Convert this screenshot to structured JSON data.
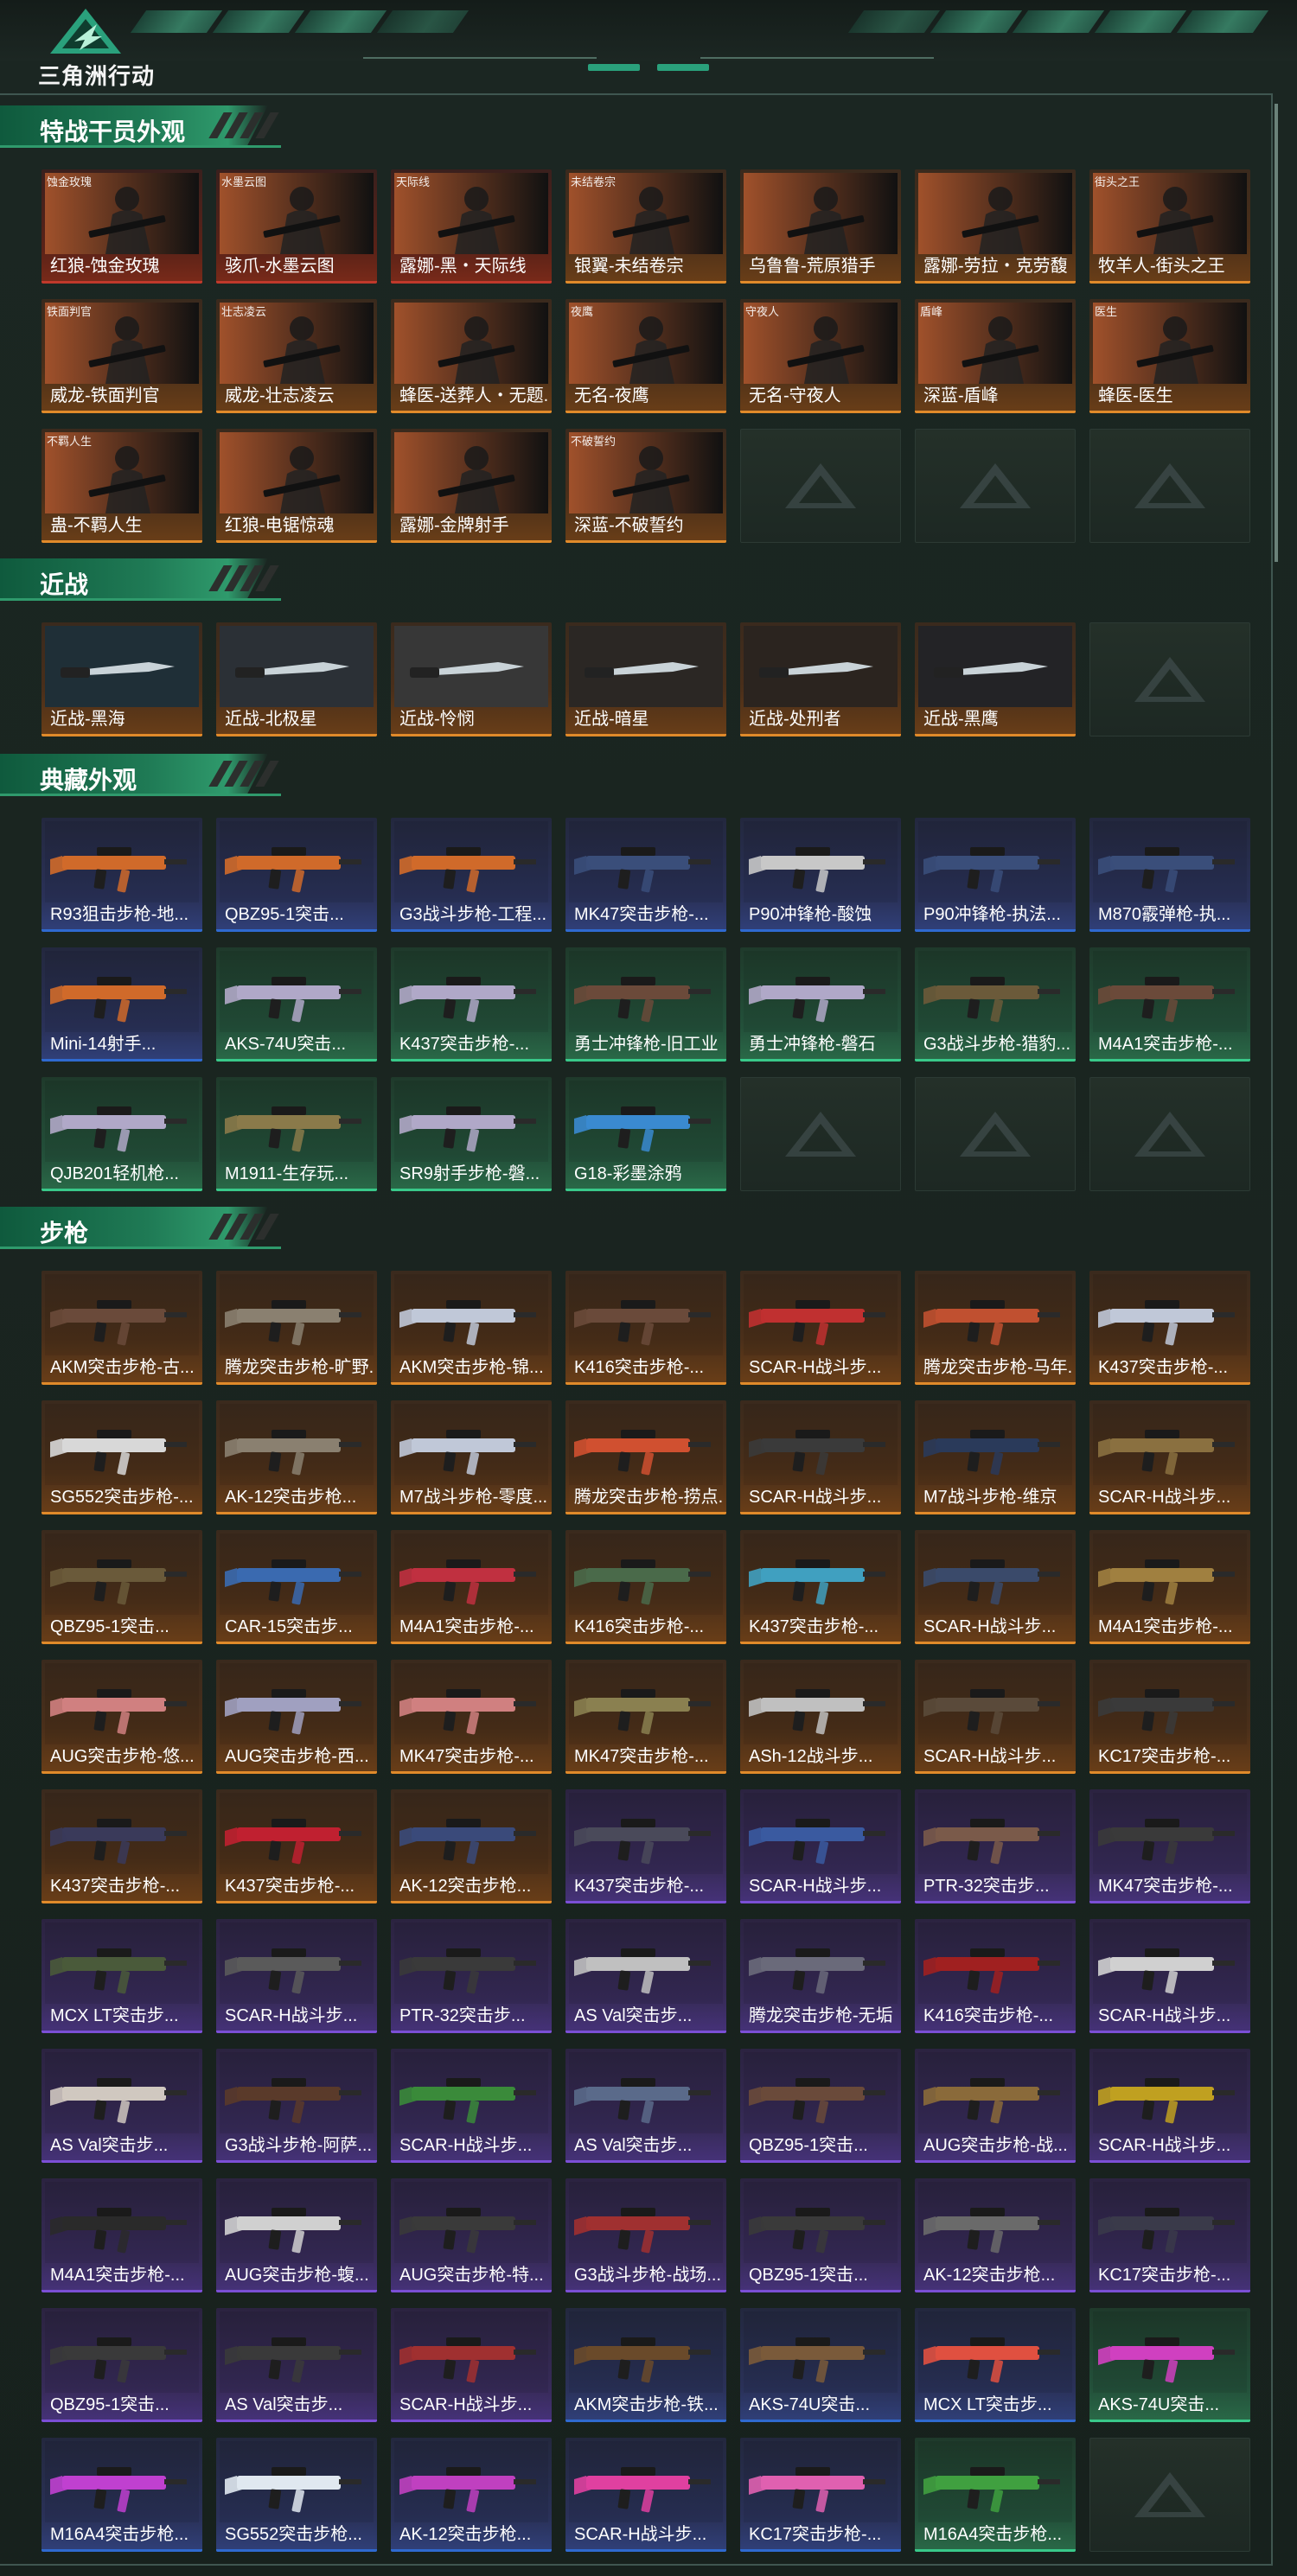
{
  "app": {
    "logo_text": "三角洲行动"
  },
  "colors": {
    "gold": "#e08a2a",
    "red": "#c0392b",
    "blue": "#2f6ad0",
    "purple": "#7b4fd6",
    "green": "#39c98a"
  },
  "sections": {
    "operators": {
      "title": "特战干员外观",
      "items": [
        {
          "label": "红狼-蚀金玫瑰",
          "tag": "蚀金玫瑰",
          "quality": "red",
          "theme": "#a0512b"
        },
        {
          "label": "骇爪-水墨云图",
          "tag": "水墨云图",
          "quality": "red",
          "theme": "#6c7680"
        },
        {
          "label": "露娜-黑・天际线",
          "tag": "天际线",
          "quality": "red",
          "theme": "#3a4a70"
        },
        {
          "label": "银翼-未结卷宗",
          "tag": "未结卷宗",
          "quality": "gold",
          "theme": "#2c4a5a"
        },
        {
          "label": "乌鲁鲁-荒原猎手",
          "tag": "",
          "quality": "gold",
          "theme": "#3d6b86"
        },
        {
          "label": "露娜-劳拉・克劳馥",
          "tag": "",
          "quality": "gold",
          "theme": "#2f5660"
        },
        {
          "label": "牧羊人-街头之王",
          "tag": "街头之王",
          "quality": "gold",
          "theme": "#47616a"
        },
        {
          "label": "威龙-铁面判官",
          "tag": "铁面判官",
          "quality": "gold",
          "theme": "#2c5660"
        },
        {
          "label": "威龙-壮志凌云",
          "tag": "壮志凌云",
          "quality": "gold",
          "theme": "#3c4c52"
        },
        {
          "label": "蜂医-送葬人・无题...",
          "tag": "",
          "quality": "gold",
          "theme": "#2a6670"
        },
        {
          "label": "无名-夜鹰",
          "tag": "夜鹰",
          "quality": "gold",
          "theme": "#2d4050"
        },
        {
          "label": "无名-守夜人",
          "tag": "守夜人",
          "quality": "gold",
          "theme": "#2b2f33"
        },
        {
          "label": "深蓝-盾峰",
          "tag": "盾峰",
          "quality": "gold",
          "theme": "#3a6170"
        },
        {
          "label": "蜂医-医生",
          "tag": "医生",
          "quality": "gold",
          "theme": "#3b6070"
        },
        {
          "label": "蛊-不羁人生",
          "tag": "不羁人生",
          "quality": "gold",
          "theme": "#4a3350"
        },
        {
          "label": "红狼-电锯惊魂",
          "tag": "",
          "quality": "gold",
          "theme": "#4c2a26"
        },
        {
          "label": "露娜-金牌射手",
          "tag": "",
          "quality": "gold",
          "theme": "#6a5a4a"
        },
        {
          "label": "深蓝-不破誓约",
          "tag": "不破誓约",
          "quality": "gold",
          "theme": "#2c5a5e"
        },
        {
          "empty": true
        },
        {
          "empty": true
        },
        {
          "empty": true
        }
      ]
    },
    "melee": {
      "title": "近战",
      "items": [
        {
          "label": "近战-黑海",
          "quality": "gold",
          "theme": "#2a3f4a"
        },
        {
          "label": "近战-北极星",
          "quality": "gold",
          "theme": "#3a4048"
        },
        {
          "label": "近战-怜悯",
          "quality": "gold",
          "theme": "#4a4a4a"
        },
        {
          "label": "近战-暗星",
          "quality": "gold",
          "theme": "#3a3430"
        },
        {
          "label": "近战-处刑者",
          "quality": "gold",
          "theme": "#3a302a"
        },
        {
          "label": "近战-黑鹰",
          "quality": "gold",
          "theme": "#2f2f33"
        },
        {
          "empty": true
        }
      ]
    },
    "collection": {
      "title": "典藏外观",
      "items": [
        {
          "label": "R93狙击步枪-地...",
          "quality": "blue",
          "theme": "#d06a2a"
        },
        {
          "label": "QBZ95-1突击...",
          "quality": "blue",
          "theme": "#d06a2a"
        },
        {
          "label": "G3战斗步枪-工程...",
          "quality": "blue",
          "theme": "#d06a2a"
        },
        {
          "label": "MK47突击步枪-...",
          "quality": "blue",
          "theme": "#3a4e7a"
        },
        {
          "label": "P90冲锋枪-酸蚀",
          "quality": "blue",
          "theme": "#c8c8c8"
        },
        {
          "label": "P90冲锋枪-执法...",
          "quality": "blue",
          "theme": "#3a4e7a"
        },
        {
          "label": "M870霰弹枪-执...",
          "quality": "blue",
          "theme": "#3a4e7a"
        },
        {
          "label": "Mini-14射手...",
          "quality": "blue",
          "theme": "#d06a2a"
        },
        {
          "label": "AKS-74U突击...",
          "quality": "green",
          "theme": "#b0a8c8"
        },
        {
          "label": "K437突击步枪-...",
          "quality": "green",
          "theme": "#b0a8c8"
        },
        {
          "label": "勇士冲锋枪-旧工业",
          "quality": "green",
          "theme": "#6b4a3a"
        },
        {
          "label": "勇士冲锋枪-磐石",
          "quality": "green",
          "theme": "#b0a8c8"
        },
        {
          "label": "G3战斗步枪-猎豹...",
          "quality": "green",
          "theme": "#6b5a3a"
        },
        {
          "label": "M4A1突击步枪-...",
          "quality": "green",
          "theme": "#6b4a3a"
        },
        {
          "label": "QJB201轻机枪...",
          "quality": "green",
          "theme": "#b0a8c8"
        },
        {
          "label": "M1911-生存玩...",
          "quality": "green",
          "theme": "#8a7a4a"
        },
        {
          "label": "SR9射手步枪-磐...",
          "quality": "green",
          "theme": "#b0a8c8"
        },
        {
          "label": "G18-彩墨涂鸦",
          "quality": "green",
          "theme": "#3a8ad0"
        },
        {
          "empty": true
        },
        {
          "empty": true
        },
        {
          "empty": true
        }
      ]
    },
    "rifles": {
      "title": "步枪",
      "items": [
        {
          "label": "AKM突击步枪-古...",
          "quality": "gold",
          "theme": "#6a4a3a"
        },
        {
          "label": "腾龙突击步枪-旷野...",
          "quality": "gold",
          "theme": "#8a8070"
        },
        {
          "label": "AKM突击步枪-锦...",
          "quality": "gold",
          "theme": "#c0c8d8"
        },
        {
          "label": "K416突击步枪-...",
          "quality": "gold",
          "theme": "#6a4a3a"
        },
        {
          "label": "SCAR-H战斗步...",
          "quality": "gold",
          "theme": "#c03030"
        },
        {
          "label": "腾龙突击步枪-马年...",
          "quality": "gold",
          "theme": "#c05030"
        },
        {
          "label": "K437突击步枪-...",
          "quality": "gold",
          "theme": "#c0c8d8"
        },
        {
          "label": "SG552突击步枪-...",
          "quality": "gold",
          "theme": "#d8d8d8"
        },
        {
          "label": "AK-12突击步枪...",
          "quality": "gold",
          "theme": "#8a8070"
        },
        {
          "label": "M7战斗步枪-零度...",
          "quality": "gold",
          "theme": "#c0c8d8"
        },
        {
          "label": "腾龙突击步枪-捞点...",
          "quality": "gold",
          "theme": "#d05030"
        },
        {
          "label": "SCAR-H战斗步...",
          "quality": "gold",
          "theme": "#3a3a3a"
        },
        {
          "label": "M7战斗步枪-维京",
          "quality": "gold",
          "theme": "#2a3a5a"
        },
        {
          "label": "SCAR-H战斗步...",
          "quality": "gold",
          "theme": "#8a7040"
        },
        {
          "label": "QBZ95-1突击...",
          "quality": "gold",
          "theme": "#6a5a3a"
        },
        {
          "label": "CAR-15突击步...",
          "quality": "gold",
          "theme": "#3a6ab0"
        },
        {
          "label": "M4A1突击步枪-...",
          "quality": "gold",
          "theme": "#c03040"
        },
        {
          "label": "K416突击步枪-...",
          "quality": "gold",
          "theme": "#4a6a4a"
        },
        {
          "label": "K437突击步枪-...",
          "quality": "gold",
          "theme": "#40a0c0"
        },
        {
          "label": "SCAR-H战斗步...",
          "quality": "gold",
          "theme": "#3a4a6a"
        },
        {
          "label": "M4A1突击步枪-...",
          "quality": "gold",
          "theme": "#a08040"
        },
        {
          "label": "AUG突击步枪-悠...",
          "quality": "gold",
          "theme": "#d08080"
        },
        {
          "label": "AUG突击步枪-西...",
          "quality": "gold",
          "theme": "#a0a0c0"
        },
        {
          "label": "MK47突击步枪-...",
          "quality": "gold",
          "theme": "#d08080"
        },
        {
          "label": "MK47突击步枪-...",
          "quality": "gold",
          "theme": "#8a8050"
        },
        {
          "label": "ASh-12战斗步...",
          "quality": "gold",
          "theme": "#c0c0c0"
        },
        {
          "label": "SCAR-H战斗步...",
          "quality": "gold",
          "theme": "#5a4a3a"
        },
        {
          "label": "KC17突击步枪-...",
          "quality": "gold",
          "theme": "#3a3a3a"
        },
        {
          "label": "K437突击步枪-...",
          "quality": "gold",
          "theme": "#3a3a5a"
        },
        {
          "label": "K437突击步枪-...",
          "quality": "gold",
          "theme": "#c02030"
        },
        {
          "label": "AK-12突击步枪...",
          "quality": "gold",
          "theme": "#3a4a7a"
        },
        {
          "label": "K437突击步枪-...",
          "quality": "purple",
          "theme": "#4a4a5a"
        },
        {
          "label": "SCAR-H战斗步...",
          "quality": "purple",
          "theme": "#3a5aa0"
        },
        {
          "label": "PTR-32突击步...",
          "quality": "purple",
          "theme": "#7a5a4a"
        },
        {
          "label": "MK47突击步枪-...",
          "quality": "purple",
          "theme": "#3a3a3a"
        },
        {
          "label": "MCX LT突击步...",
          "quality": "purple",
          "theme": "#4a5a3a"
        },
        {
          "label": "SCAR-H战斗步...",
          "quality": "purple",
          "theme": "#5a5a5a"
        },
        {
          "label": "PTR-32突击步...",
          "quality": "purple",
          "theme": "#3a3a3a"
        },
        {
          "label": "AS Val突击步...",
          "quality": "purple",
          "theme": "#c0c0c0"
        },
        {
          "label": "腾龙突击步枪-无垢",
          "quality": "purple",
          "theme": "#6a6a7a"
        },
        {
          "label": "K416突击步枪-...",
          "quality": "purple",
          "theme": "#a02020"
        },
        {
          "label": "SCAR-H战斗步...",
          "quality": "purple",
          "theme": "#d0d0d0"
        },
        {
          "label": "AS Val突击步...",
          "quality": "purple",
          "theme": "#d0c8c0"
        },
        {
          "label": "G3战斗步枪-阿萨...",
          "quality": "purple",
          "theme": "#5a3a2a"
        },
        {
          "label": "SCAR-H战斗步...",
          "quality": "purple",
          "theme": "#3a8a3a"
        },
        {
          "label": "AS Val突击步...",
          "quality": "purple",
          "theme": "#5a6a8a"
        },
        {
          "label": "QBZ95-1突击...",
          "quality": "purple",
          "theme": "#6a4a3a"
        },
        {
          "label": "AUG突击步枪-战...",
          "quality": "purple",
          "theme": "#8a6a3a"
        },
        {
          "label": "SCAR-H战斗步...",
          "quality": "purple",
          "theme": "#c0a020"
        },
        {
          "label": "M4A1突击步枪-...",
          "quality": "purple",
          "theme": "#2a2a2a"
        },
        {
          "label": "AUG突击步枪-蝮...",
          "quality": "purple",
          "theme": "#d0d0d0"
        },
        {
          "label": "AUG突击步枪-特...",
          "quality": "purple",
          "theme": "#3a3a3a"
        },
        {
          "label": "G3战斗步枪-战场...",
          "quality": "purple",
          "theme": "#a03030"
        },
        {
          "label": "QBZ95-1突击...",
          "quality": "purple",
          "theme": "#3a3a3a"
        },
        {
          "label": "AK-12突击步枪...",
          "quality": "purple",
          "theme": "#6a6a6a"
        },
        {
          "label": "KC17突击步枪-...",
          "quality": "purple",
          "theme": "#3a3a4a"
        },
        {
          "label": "QBZ95-1突击...",
          "quality": "purple",
          "theme": "#3a3a3a"
        },
        {
          "label": "AS Val突击步...",
          "quality": "purple",
          "theme": "#3a3a3a"
        },
        {
          "label": "SCAR-H战斗步...",
          "quality": "purple",
          "theme": "#a03030"
        },
        {
          "label": "AKM突击步枪-铁...",
          "quality": "blue",
          "theme": "#6a4a2a"
        },
        {
          "label": "AKS-74U突击...",
          "quality": "blue",
          "theme": "#7a5a3a"
        },
        {
          "label": "MCX LT突击步...",
          "quality": "blue",
          "theme": "#e05040"
        },
        {
          "label": "AKS-74U突击...",
          "quality": "green",
          "theme": "#d040c0"
        },
        {
          "label": "M16A4突击步枪...",
          "quality": "blue",
          "theme": "#c040d0"
        },
        {
          "label": "SG552突击步枪...",
          "quality": "blue",
          "theme": "#e0e8f0"
        },
        {
          "label": "AK-12突击步枪...",
          "quality": "blue",
          "theme": "#c040c0"
        },
        {
          "label": "SCAR-H战斗步...",
          "quality": "blue",
          "theme": "#e040a0"
        },
        {
          "label": "KC17突击步枪-...",
          "quality": "blue",
          "theme": "#e060b0"
        },
        {
          "label": "M16A4突击步枪...",
          "quality": "green",
          "theme": "#40a040"
        },
        {
          "empty": true
        }
      ]
    }
  }
}
